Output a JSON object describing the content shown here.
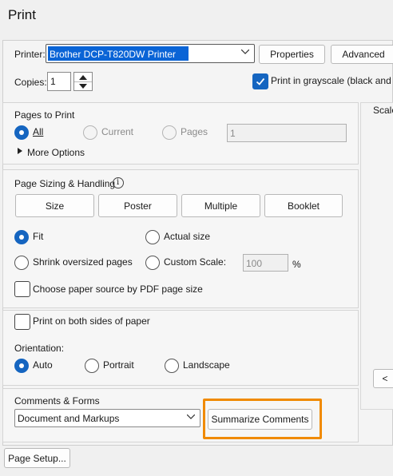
{
  "window": {
    "title": "Print"
  },
  "printer": {
    "label": "Printer:",
    "selected": "Brother DCP-T820DW Printer",
    "properties_label": "Properties",
    "advanced_label": "Advanced",
    "copies_label": "Copies:",
    "copies_value": "1",
    "grayscale_label": "Print in grayscale (black and wh",
    "grayscale_checked": true
  },
  "pages_to_print": {
    "heading": "Pages to Print",
    "options": [
      "All",
      "Current",
      "Pages"
    ],
    "pages_value": "1",
    "more_options": "More Options"
  },
  "page_sizing": {
    "heading": "Page Sizing & Handling",
    "tabs": [
      "Size",
      "Poster",
      "Multiple",
      "Booklet"
    ],
    "fit_label": "Fit",
    "actual_size_label": "Actual size",
    "shrink_label": "Shrink oversized pages",
    "custom_scale_label": "Custom Scale:",
    "custom_scale_value": "100",
    "percent": "%",
    "paper_source_label": "Choose paper source by PDF page size"
  },
  "duplex": {
    "both_sides_label": "Print on both sides of paper",
    "orientation_label": "Orientation:",
    "options": [
      "Auto",
      "Portrait",
      "Landscape"
    ]
  },
  "comments_forms": {
    "heading": "Comments & Forms",
    "selected": "Document and Markups",
    "summarize_label": "Summarize Comments",
    "highlight_color": "#f08a00"
  },
  "preview": {
    "scale_label": "Scale",
    "nav_prev": "<"
  },
  "footer": {
    "page_setup_label": "Page Setup..."
  }
}
